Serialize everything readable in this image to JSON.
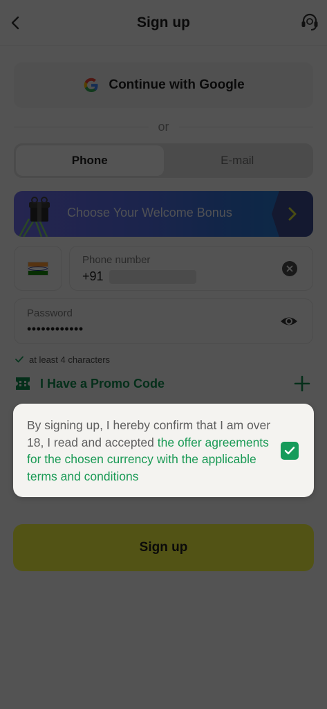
{
  "header": {
    "title": "Sign up",
    "back_icon": "chevron-left-icon",
    "support_icon": "headset-icon"
  },
  "auth": {
    "google_label": "Continue with Google",
    "or_text": "or"
  },
  "tabs": [
    {
      "label": "Phone",
      "active": true
    },
    {
      "label": "E-mail",
      "active": false
    }
  ],
  "bonus": {
    "label": "Choose Your Welcome Bonus"
  },
  "phone": {
    "label": "Phone number",
    "prefix": "+91"
  },
  "password": {
    "label": "Password",
    "value": "••••••••••••"
  },
  "validation": {
    "rule": "at least 4 characters"
  },
  "promo": {
    "label": "I Have a Promo Code"
  },
  "terms": {
    "text": "By signing up, I hereby confirm that I am over 18, I read and accepted ",
    "link_text": "the offer agreements for the chosen currency with the applicable terms and conditions",
    "checked": true
  },
  "signup": {
    "label": "Sign up"
  },
  "colors": {
    "accent_green": "#169b5a",
    "signup_yellow": "#f0f43f",
    "overlay": "rgba(0,0,0,0.66)"
  }
}
